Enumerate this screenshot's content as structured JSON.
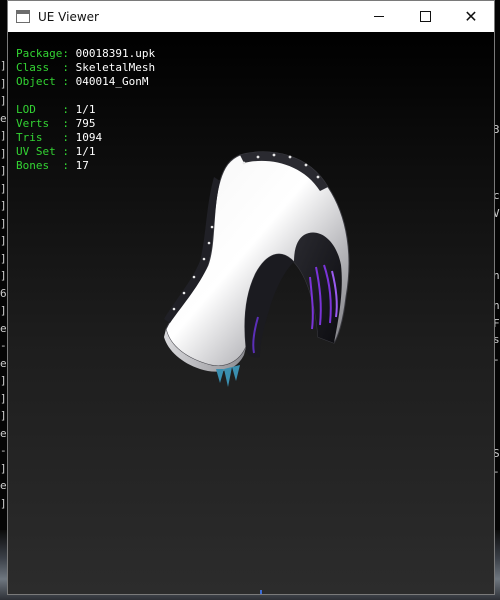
{
  "window": {
    "title": "UE Viewer"
  },
  "controls": {
    "minimize": "minimize",
    "maximize": "maximize",
    "close": "✕"
  },
  "info": {
    "package": {
      "label": "Package:",
      "value": "00018391.upk"
    },
    "class": {
      "label": "Class  :",
      "value": "SkeletalMesh"
    },
    "object": {
      "label": "Object :",
      "value": "040014_GonM"
    },
    "lod": {
      "label": "LOD    :",
      "value": "1/1"
    },
    "verts": {
      "label": "Verts  :",
      "value": "795"
    },
    "tris": {
      "label": "Tris   :",
      "value": "1094"
    },
    "uvset": {
      "label": "UV Set :",
      "value": "1/1"
    },
    "bones": {
      "label": "Bones  :",
      "value": "17"
    }
  },
  "background": {
    "left_marks": [
      "]",
      "]",
      "]",
      "e",
      "]",
      "]",
      "]",
      "]",
      "]",
      "]",
      "]",
      "]",
      "]",
      "6",
      "]",
      "e",
      "-",
      "e",
      "]",
      "]",
      "]",
      "e",
      "-",
      "]",
      "e",
      "]"
    ],
    "right_marks": [
      "3",
      "c",
      "V",
      "n",
      "n",
      "F",
      "s",
      "-",
      "S",
      "-"
    ]
  },
  "colors": {
    "label": "#33d433",
    "value": "#ffffff",
    "viewport_top": "#000000",
    "viewport_bottom": "#2c2c2c"
  },
  "icons": {
    "app": "app-window-icon",
    "minimize": "minimize-icon",
    "maximize": "maximize-icon",
    "close": "close-icon"
  }
}
